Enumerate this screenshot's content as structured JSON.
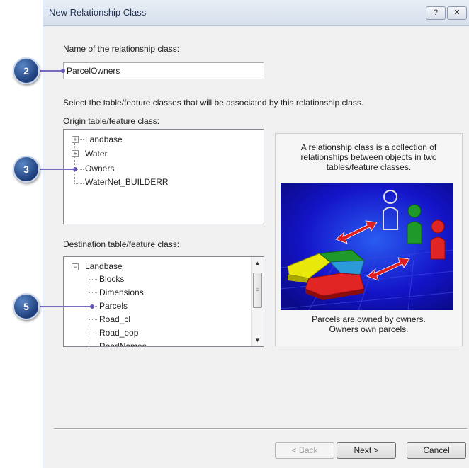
{
  "dialog": {
    "title": "New Relationship Class",
    "help_glyph": "?",
    "close_glyph": "✕"
  },
  "name_section": {
    "label": "Name of the relationship class:",
    "value": "ParcelOwners"
  },
  "instruction": "Select the table/feature classes that will be associated by this relationship class.",
  "origin": {
    "label": "Origin table/feature class:",
    "items": [
      {
        "label": "Landbase",
        "expandable": true
      },
      {
        "label": "Water",
        "expandable": true
      },
      {
        "label": "Owners",
        "expandable": false
      },
      {
        "label": "WaterNet_BUILDERR",
        "expandable": false
      }
    ]
  },
  "destination": {
    "label": "Destination table/feature class:",
    "root": {
      "label": "Landbase",
      "expanded": true
    },
    "children": [
      "Blocks",
      "Dimensions",
      "Parcels",
      "Road_cl",
      "Road_eop",
      "RoadNames"
    ]
  },
  "info_panel": {
    "top_text": "A relationship class is a collection of\nrelationships between objects in two\ntables/feature classes.",
    "bottom_text": "Parcels are owned by owners.\nOwners own parcels."
  },
  "buttons": {
    "back": "< Back",
    "next": "Next >",
    "cancel": "Cancel"
  },
  "callouts": [
    "2",
    "3",
    "5"
  ],
  "colors": {
    "callout": "#2a4f8f",
    "illustration_bg": "#1010c8",
    "arrow": "#e02020"
  }
}
